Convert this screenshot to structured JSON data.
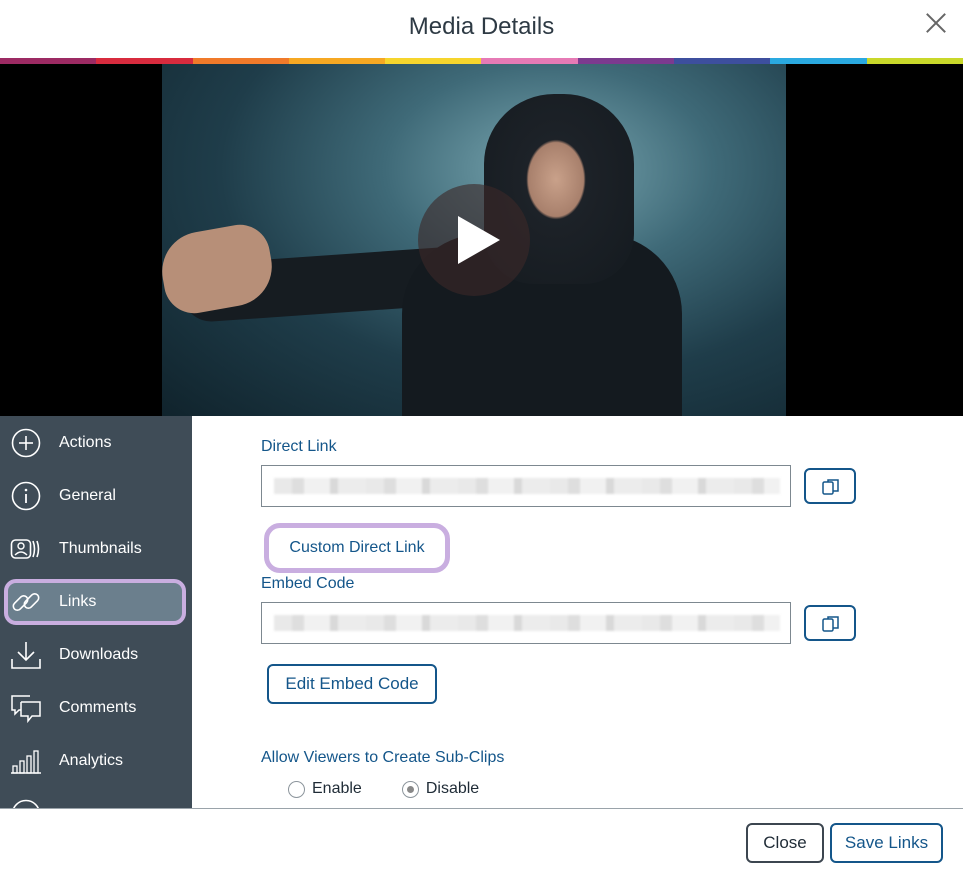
{
  "dialog": {
    "title": "Media Details"
  },
  "strip_colors": [
    "#9c2a63",
    "#d82b3e",
    "#f07a2a",
    "#f6a823",
    "#f6d52d",
    "#e67ab5",
    "#7c3a8f",
    "#3d4f9e",
    "#2aa9e0",
    "#c9d82a"
  ],
  "sidebar": {
    "items": [
      {
        "label": "Actions",
        "icon": "plus-circle-icon"
      },
      {
        "label": "General",
        "icon": "info-icon"
      },
      {
        "label": "Thumbnails",
        "icon": "thumbnails-icon"
      },
      {
        "label": "Links",
        "icon": "link-icon",
        "active": true
      },
      {
        "label": "Downloads",
        "icon": "download-icon"
      },
      {
        "label": "Comments",
        "icon": "comments-icon"
      },
      {
        "label": "Analytics",
        "icon": "analytics-icon"
      }
    ]
  },
  "links": {
    "direct_link_label": "Direct Link",
    "custom_direct_link_label": "Custom Direct Link",
    "embed_code_label": "Embed Code",
    "edit_embed_code_label": "Edit Embed Code",
    "subclips_label": "Allow Viewers to Create Sub-Clips",
    "enable_label": "Enable",
    "disable_label": "Disable",
    "selected_subclip_option": "Disable"
  },
  "footer": {
    "close_label": "Close",
    "save_label": "Save Links"
  },
  "colors": {
    "accent": "#14568a",
    "sidebar_bg": "#3f4c57",
    "highlight": "#c9aee0"
  }
}
